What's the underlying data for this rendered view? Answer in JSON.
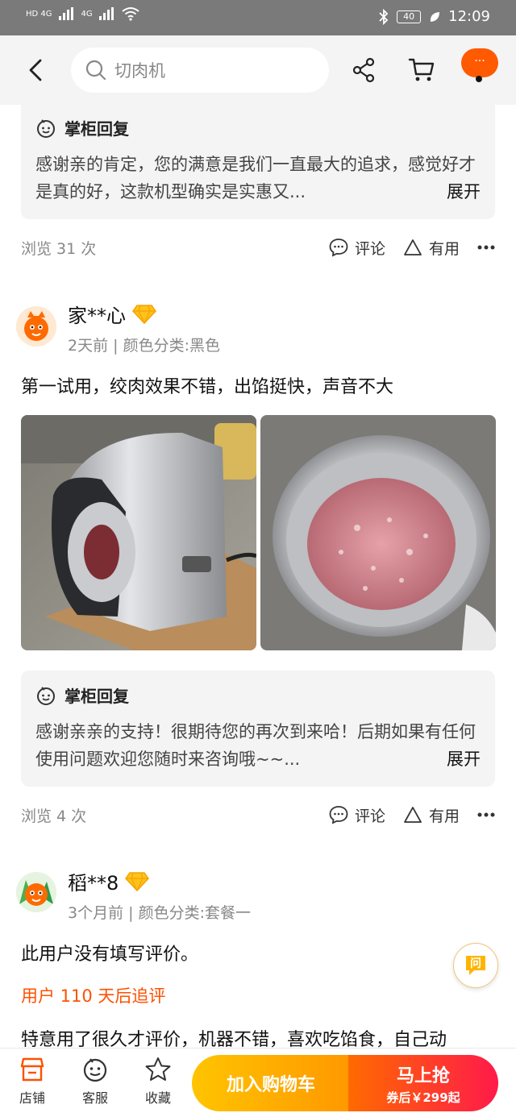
{
  "status_bar": {
    "net_left_1": "HD 4G",
    "net_left_2": "4G",
    "battery": "40",
    "time": "12:09"
  },
  "header": {
    "search_placeholder": "切肉机",
    "more_label": "···"
  },
  "review_prev": {
    "reply_title": "掌柜回复",
    "reply_text": "感谢亲的肯定，您的满意是我们一直最大的追求，感觉好才是真的好，这款机型确实是实惠又...",
    "expand": "展开",
    "views": "浏览 31 次",
    "comment": "评论",
    "useful": "有用"
  },
  "review_1": {
    "user": "家**心",
    "meta": "2天前 | 颜色分类:黑色",
    "content": "第一试用，绞肉效果不错，出馅挺快，声音不大",
    "reply_title": "掌柜回复",
    "reply_text": "感谢亲亲的支持！很期待您的再次到来哈！后期如果有任何使用问题欢迎您随时来咨询哦~~...",
    "expand": "展开",
    "views": "浏览 4 次",
    "comment": "评论",
    "useful": "有用"
  },
  "review_2": {
    "user": "稻**8",
    "meta": "3个月前 | 颜色分类:套餐一",
    "content": "此用户没有填写评价。",
    "followup_label": "用户 110 天后追评",
    "followup_text": "特意用了很久才评价，机器不错，喜欢吃馅食，自己动"
  },
  "ask_label": "问",
  "bottom_bar": {
    "shop": "店铺",
    "service": "客服",
    "favorite": "收藏",
    "add_to_cart": "加入购物车",
    "buy_now": "马上抢",
    "buy_sub": "券后￥299起"
  },
  "colors": {
    "accent": "#ff5000",
    "cart_button": "#ffb300",
    "buy_button": "#ff2a3d"
  }
}
